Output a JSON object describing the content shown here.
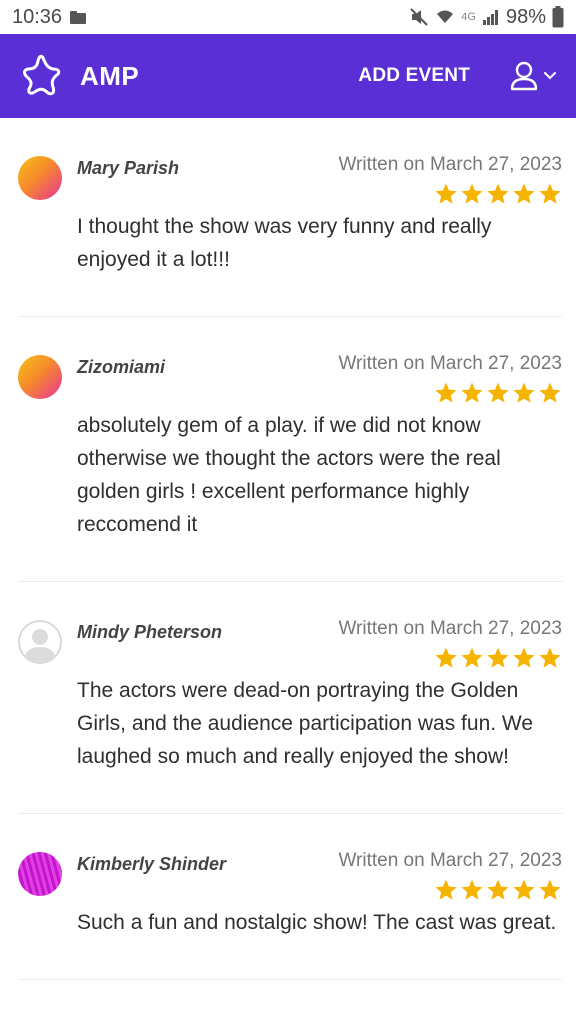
{
  "status_bar": {
    "time": "10:36",
    "network": "4G",
    "battery": "98%"
  },
  "app_bar": {
    "brand": "AMP",
    "add_event_label": "ADD EVENT",
    "color": "#5a2fd6"
  },
  "reviews": [
    {
      "name": "Mary Parish",
      "date": "Written on March 27, 2023",
      "rating": 5,
      "text": "I thought the show was very funny and really enjoyed it a lot!!!",
      "avatar": "warm"
    },
    {
      "name": "Zizomiami",
      "date": "Written on March 27, 2023",
      "rating": 5,
      "text": "absolutely gem of a play. if we did not know otherwise we thought the actors were the real golden girls ! excellent performance highly reccomend it",
      "avatar": "warm"
    },
    {
      "name": "Mindy Pheterson",
      "date": "Written on March 27, 2023",
      "rating": 5,
      "text": "The actors were dead-on portraying the Golden Girls, and the audience participation was fun. We laughed so much and really enjoyed the show!",
      "avatar": "default"
    },
    {
      "name": "Kimberly Shinder",
      "date": "Written on March 27, 2023",
      "rating": 5,
      "text": "Such a fun and nostalgic show! The cast was great.",
      "avatar": "pink"
    }
  ],
  "colors": {
    "star": "#f5b400"
  }
}
